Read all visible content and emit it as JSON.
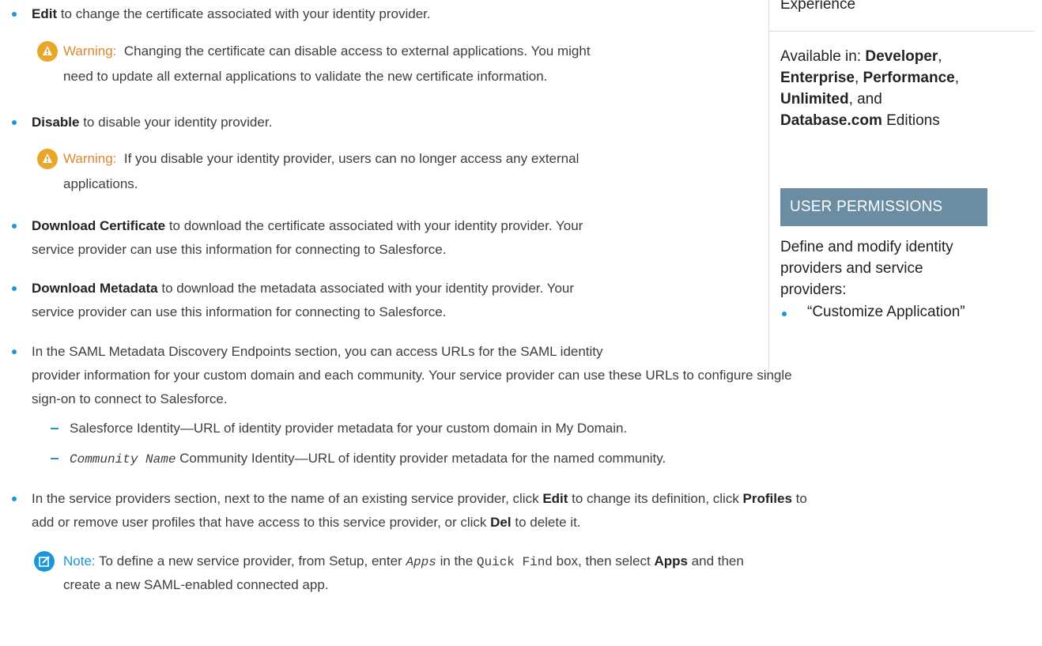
{
  "colors": {
    "bullet": "#1b96d8",
    "warning": "#e0862e",
    "note": "#1b96d8",
    "permission_header_bg": "#6a8da4"
  },
  "items": {
    "edit": {
      "label": "Edit",
      "text": " to change the certificate associated with your identity provider."
    },
    "warning1": {
      "label": "Warning:",
      "line1": "Changing the certificate can disable access to external applications. You might",
      "line2": "need to update all external applications to validate the new certificate information."
    },
    "disable": {
      "label": "Disable",
      "text": " to disable your identity provider."
    },
    "warning2": {
      "label": "Warning:",
      "line1": "If you disable your identity provider, users can no longer access any external",
      "line2": "applications."
    },
    "download_cert": {
      "label": "Download Certificate",
      "line1": " to download the certificate associated with your identity provider. Your",
      "line2": "service provider can use this information for connecting to Salesforce."
    },
    "download_meta": {
      "label": "Download Metadata",
      "line1": " to download the metadata associated with your identity provider. Your",
      "line2": "service provider can use this information for connecting to Salesforce."
    },
    "saml": {
      "line1": "In the SAML Metadata Discovery Endpoints section, you can access URLs for the SAML identity",
      "line2": "provider information for your custom domain and each community. Your service provider can use these URLs to configure single",
      "line3": "sign-on to connect to Salesforce.",
      "sub1": "Salesforce Identity—URL of identity provider metadata for your custom domain in My Domain.",
      "sub2_code": "Community Name",
      "sub2": " Community Identity—URL of identity provider metadata for the named community."
    },
    "service": {
      "part1": "In the service providers section, next to the name of an existing service provider, click ",
      "edit": "Edit",
      "part2": " to change its definition, click ",
      "profiles": "Profiles",
      "part3": " to",
      "line2a": "add or remove user profiles that have access to this service provider, or click ",
      "del": "Del",
      "line2b": " to delete it."
    },
    "note": {
      "label": "Note:",
      "part1": " To define a new service provider, from Setup, enter ",
      "apps_code": "Apps",
      "part2": " in the ",
      "quickfind_code": "Quick Find",
      "part3": " box, then select ",
      "apps_bold": "Apps",
      "part4": " and then",
      "line2": "create a new SAML-enabled connected app."
    }
  },
  "sidebar": {
    "experience_label": "Experience",
    "available_prefix": "Available in: ",
    "editions": [
      "Developer",
      "Enterprise",
      "Performance",
      "Unlimited",
      "Database.com"
    ],
    "sep1": ",",
    "sep2": ",",
    "sep3": ",",
    "sep4": ", and",
    "editions_suffix": " Editions",
    "permissions_header": "USER PERMISSIONS",
    "permission_desc_line1": "Define and modify identity",
    "permission_desc_line2": "providers and service",
    "permission_desc_line3": "providers:",
    "permission_item": "“Customize Application”"
  }
}
